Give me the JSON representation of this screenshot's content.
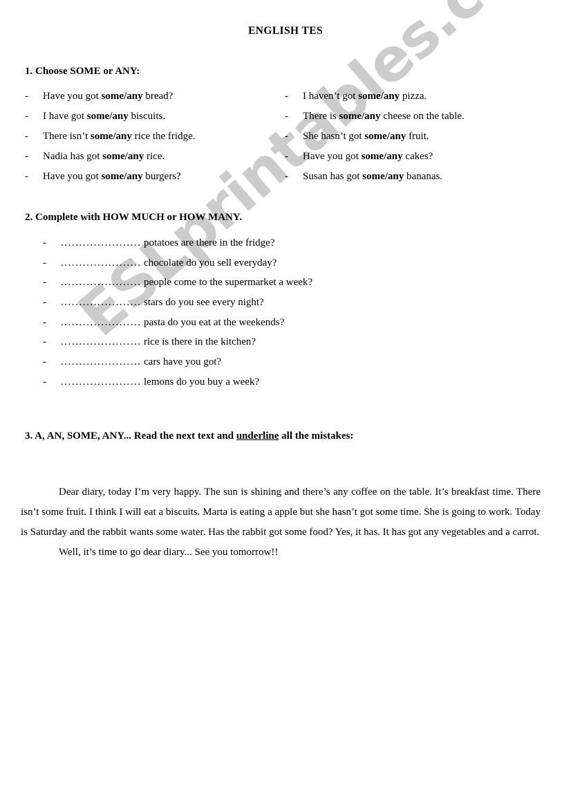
{
  "document": {
    "title": "ENGLISH TES",
    "watermark": "ESLprintables.com",
    "watermark_color": "#cccccc",
    "page_background": "#ffffff",
    "text_color": "#000000"
  },
  "exercise1": {
    "heading": "1. Choose SOME or ANY:",
    "bullet": "-",
    "left_items": [
      {
        "before": "Have you got ",
        "choice": "some/any",
        "after": " bread?"
      },
      {
        "before": "I have got ",
        "choice": "some/any",
        "after": " biscuits."
      },
      {
        "before": "There isn’t ",
        "choice": "some/any",
        "after": " rice the fridge."
      },
      {
        "before": "Nadia has got ",
        "choice": "some/any",
        "after": " rice."
      },
      {
        "before": "Have you got ",
        "choice": "some/any",
        "after": " burgers?"
      }
    ],
    "right_items": [
      {
        "before": "I haven’t got ",
        "choice": "some/any",
        "after": " pizza."
      },
      {
        "before": "There is ",
        "choice": "some/any",
        "after": " cheese on the table."
      },
      {
        "before": "She hasn’t got ",
        "choice": "some/any",
        "after": " fruit."
      },
      {
        "before": "Have you got ",
        "choice": "some/any",
        "after": " cakes?"
      },
      {
        "before": "Susan has got ",
        "choice": "some/any",
        "after": " bananas."
      }
    ]
  },
  "exercise2": {
    "heading": "2. Complete with HOW MUCH or HOW MANY.",
    "bullet": "-",
    "leader": ".............................................",
    "items": [
      "potatoes are there in the fridge?",
      "chocolate do you sell everyday?",
      "people come to the supermarket a week?",
      "stars do you see every night?",
      "pasta do you eat at the weekends?",
      "rice is there in the kitchen?",
      "cars have you got?",
      "lemons do you buy a week?"
    ]
  },
  "exercise3": {
    "heading_part1": "3. A, AN, SOME, ANY... Read the next text and ",
    "heading_underlined": "underline",
    "heading_part2": " all the mistakes:",
    "paragraph1": "Dear diary, today I’m very happy. The sun is shining and there’s any coffee on the table. It’s breakfast time. There isn’t some fruit. I think I will eat a biscuits. Marta is eating a apple but she hasn’t got some time. She is going to work. Today is Saturday and the rabbit wants some water. Has the rabbit got some food? Yes, it has. It has got any vegetables and a carrot.",
    "paragraph2": "Well, it’s time to go dear diary... See you tomorrow!!"
  }
}
